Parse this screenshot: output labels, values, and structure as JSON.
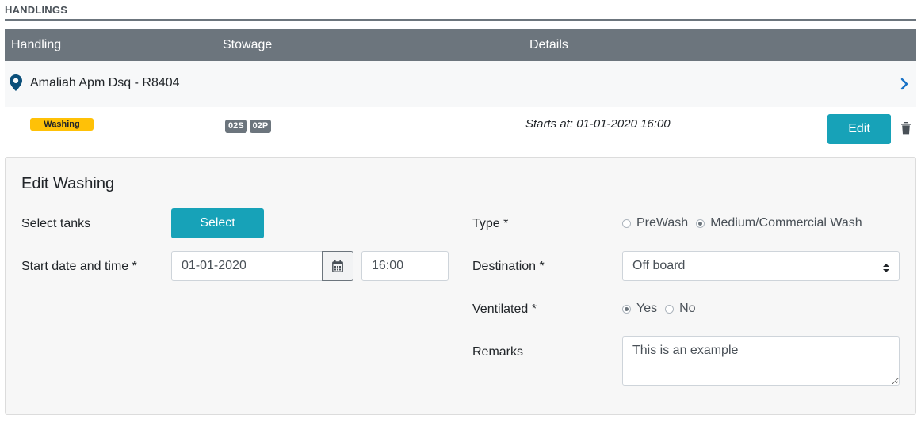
{
  "section": {
    "title": "HANDLINGS"
  },
  "table": {
    "columns": [
      "Handling",
      "Stowage",
      "Details"
    ]
  },
  "location": {
    "name": "Amaliah Apm Dsq - R8404",
    "icon": "map-pin-icon",
    "expand_icon": "chevron-right-icon"
  },
  "handling": {
    "type_label": "Washing",
    "type_color": "#ffc107",
    "stowage": [
      "02S",
      "02P"
    ],
    "details": "Starts at: 01-01-2020 16:00",
    "edit_label": "Edit",
    "delete_icon": "trash-icon"
  },
  "edit_form": {
    "title": "Edit Washing",
    "select_tanks_label": "Select tanks",
    "select_button_label": "Select",
    "start_label": "Start date and time *",
    "start_date": "01-01-2020",
    "start_time": "16:00",
    "type_label": "Type *",
    "type_options": [
      "PreWash",
      "Medium/Commercial Wash"
    ],
    "type_selected": "Medium/Commercial Wash",
    "destination_label": "Destination *",
    "destination_value": "Off board",
    "ventilated_label": "Ventilated *",
    "ventilated_options": [
      "Yes",
      "No"
    ],
    "ventilated_selected": "Yes",
    "remarks_label": "Remarks",
    "remarks_value": "This is an example"
  },
  "colors": {
    "header_bg": "#6c757d",
    "accent": "#17a2b8",
    "pin": "#0b4f7a",
    "chevron": "#1a73c7"
  }
}
